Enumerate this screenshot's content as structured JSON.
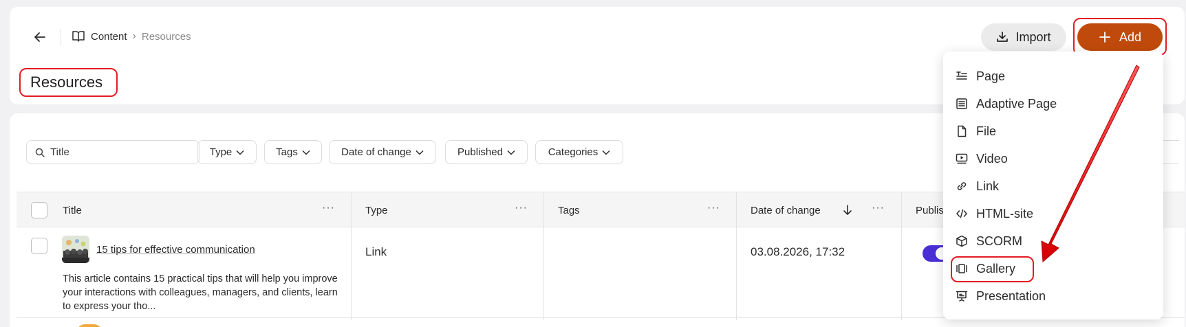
{
  "breadcrumb": {
    "root": "Content",
    "separator": "›",
    "current": "Resources"
  },
  "page": {
    "title": "Resources"
  },
  "toolbar": {
    "import_label": "Import",
    "add_label": "Add"
  },
  "search": {
    "placeholder": "Title"
  },
  "filters": [
    "Type",
    "Tags",
    "Date of change",
    "Published",
    "Categories"
  ],
  "table": {
    "columns": [
      "Title",
      "Type",
      "Tags",
      "Date of change",
      "Publis"
    ],
    "rows": [
      {
        "title": "15 tips for effective communication",
        "description": "This article contains 15 practical tips that will help you improve your interactions with colleagues, managers, and clients, learn to express your tho...",
        "type": "Link",
        "tags": "",
        "date": "03.08.2026, 17:32",
        "published": true
      }
    ]
  },
  "add_menu": {
    "items": [
      {
        "label": "Page",
        "icon": "page-icon"
      },
      {
        "label": "Adaptive Page",
        "icon": "adaptive-page-icon"
      },
      {
        "label": "File",
        "icon": "file-icon"
      },
      {
        "label": "Video",
        "icon": "video-icon"
      },
      {
        "label": "Link",
        "icon": "link-icon"
      },
      {
        "label": "HTML-site",
        "icon": "code-icon"
      },
      {
        "label": "SCORM",
        "icon": "cube-icon"
      },
      {
        "label": "Gallery",
        "icon": "gallery-icon"
      },
      {
        "label": "Presentation",
        "icon": "presentation-icon"
      }
    ]
  },
  "colors": {
    "accent": "#c04a0b",
    "annotation": "#e31b23",
    "toggle_on": "#4a2fd6"
  }
}
